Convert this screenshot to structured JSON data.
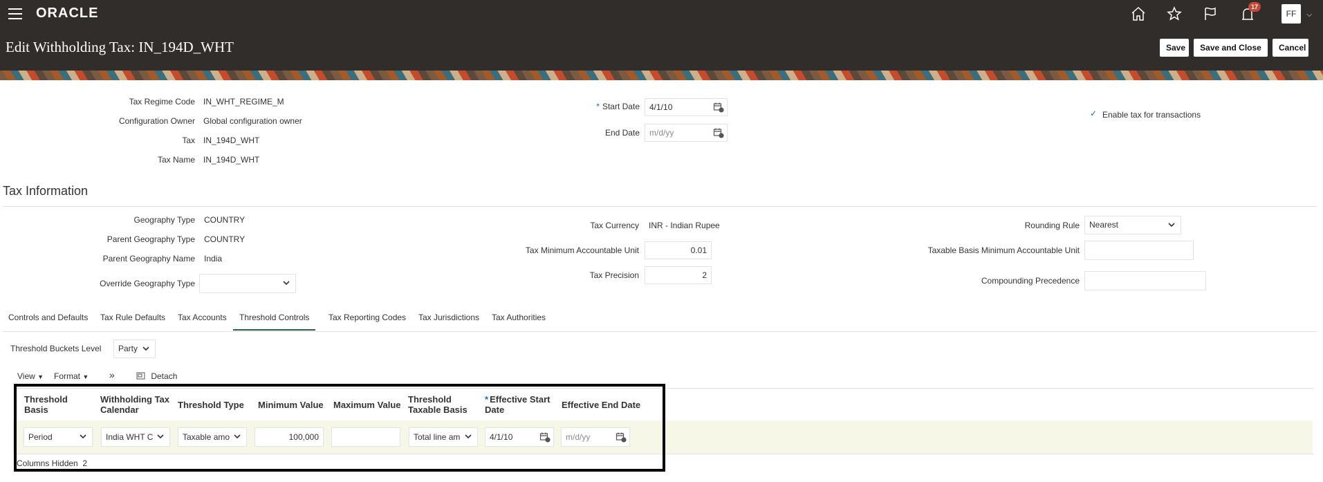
{
  "app": {
    "logo": "ORACLE",
    "notification_count": "17",
    "avatar_initials": "FF"
  },
  "header": {
    "title": "Edit Withholding Tax: IN_194D_WHT",
    "save_label": "Save",
    "save_close_label": "Save and Close",
    "cancel_label": "Cancel"
  },
  "general": {
    "tax_regime_code_label": "Tax Regime Code",
    "tax_regime_code": "IN_WHT_REGIME_M",
    "config_owner_label": "Configuration Owner",
    "config_owner": "Global configuration owner",
    "tax_label": "Tax",
    "tax": "IN_194D_WHT",
    "tax_name_label": "Tax Name",
    "tax_name": "IN_194D_WHT",
    "start_date_label": "Start Date",
    "start_date": "4/1/10",
    "end_date_label": "End Date",
    "end_date_placeholder": "m/d/yy",
    "enable_label": "Enable tax for transactions"
  },
  "tax_info": {
    "section_title": "Tax Information",
    "geography_type_label": "Geography Type",
    "geography_type": "COUNTRY",
    "parent_geography_type_label": "Parent Geography Type",
    "parent_geography_type": "COUNTRY",
    "parent_geography_name_label": "Parent Geography Name",
    "parent_geography_name": "India",
    "override_geography_type_label": "Override Geography Type",
    "tax_currency_label": "Tax Currency",
    "tax_currency": "INR - Indian Rupee",
    "tax_min_unit_label": "Tax Minimum Accountable Unit",
    "tax_min_unit": "0.01",
    "tax_precision_label": "Tax Precision",
    "tax_precision": "2",
    "rounding_rule_label": "Rounding Rule",
    "rounding_rule": "Nearest",
    "taxable_basis_min_label": "Taxable Basis Minimum Accountable Unit",
    "compounding_label": "Compounding Precedence"
  },
  "tabs": [
    {
      "label": "Controls and Defaults"
    },
    {
      "label": "Tax Rule Defaults"
    },
    {
      "label": "Tax Accounts"
    },
    {
      "label": "Threshold Controls"
    },
    {
      "label": "Tax Reporting Codes"
    },
    {
      "label": "Tax Jurisdictions"
    },
    {
      "label": "Tax Authorities"
    }
  ],
  "threshold": {
    "buckets_level_label": "Threshold Buckets Level",
    "buckets_level": "Party",
    "view_label": "View",
    "format_label": "Format",
    "detach_label": "Detach",
    "columns": [
      "Threshold Basis",
      "Withholding Tax Calendar",
      "Threshold Type",
      "Minimum Value",
      "Maximum Value",
      "Threshold Taxable Basis",
      "Effective Start Date",
      "Effective End Date"
    ],
    "row": {
      "basis": "Period",
      "calendar": "India WHT C",
      "type": "Taxable amo",
      "min_value": "100,000",
      "max_value": "",
      "taxable_basis": "Total line am",
      "start_date": "4/1/10",
      "end_date_placeholder": "m/d/yy"
    },
    "columns_hidden_label": "Columns Hidden",
    "columns_hidden_count": "2"
  },
  "colors": {
    "header_bg": "#312d2a",
    "active_tab": "#2b6242",
    "row_highlight": "#f7f7e8",
    "required": "#0572ce",
    "badge": "#c74634"
  }
}
